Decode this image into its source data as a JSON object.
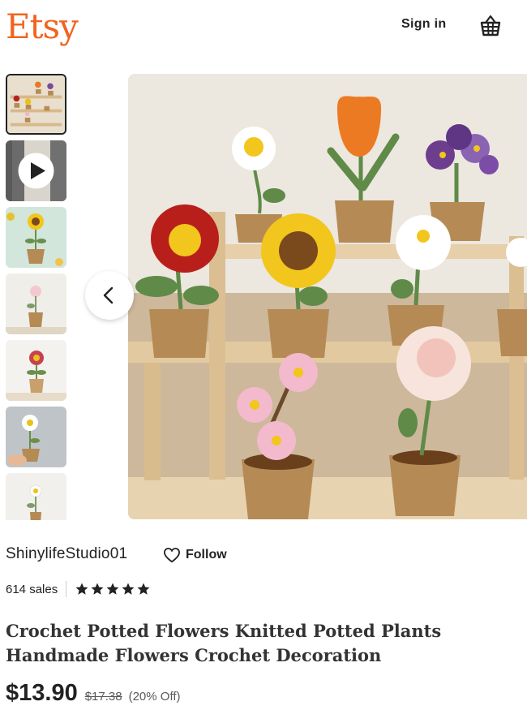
{
  "header": {
    "logo": "Etsy",
    "sign_in": "Sign in",
    "cart_icon": "basket-icon"
  },
  "gallery": {
    "thumbnail_count": 7,
    "active_index": 0,
    "video_thumbnail_index": 1,
    "prev_icon": "chevron-left-icon",
    "play_icon": "play-icon"
  },
  "shop": {
    "name": "ShinylifeStudio01",
    "follow_label": "Follow",
    "follow_icon": "heart-outline-icon",
    "sales": "614 sales",
    "rating": 5,
    "star_icon": "star-icon"
  },
  "listing": {
    "title": "Crochet Potted Flowers Knitted Potted Plants Handmade Flowers Crochet Decoration",
    "price": "$13.90",
    "original_price": "$17.38",
    "discount": "(20% Off)"
  },
  "colors": {
    "brand": "#F1641E",
    "text": "#222222",
    "muted": "#595959"
  }
}
